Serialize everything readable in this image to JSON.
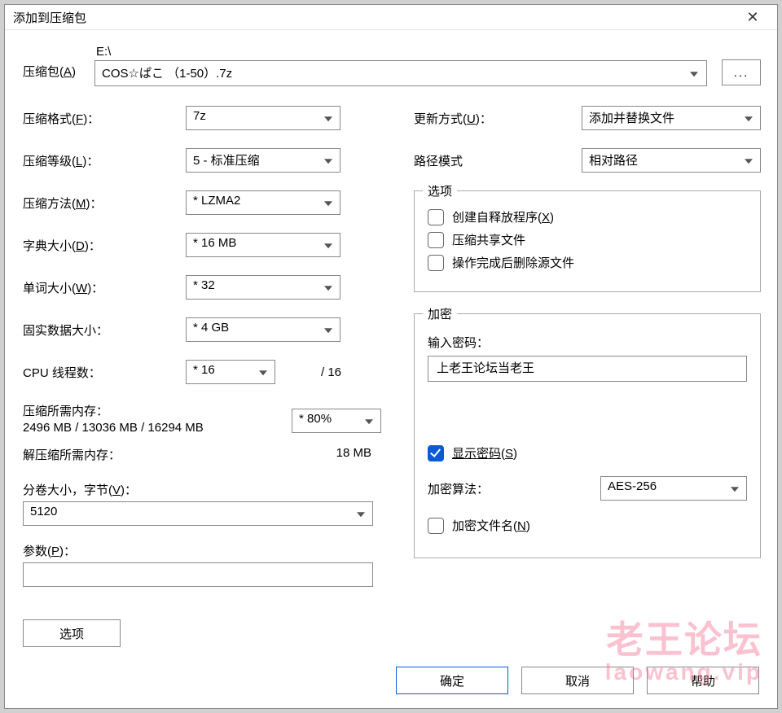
{
  "title": "添加到压缩包",
  "archive": {
    "label": "压缩包",
    "hotkey": "A",
    "path_prefix": "E:\\",
    "filename": "COS☆ぱこ （1-50）.7z",
    "browse": "..."
  },
  "left": {
    "format_label": "压缩格式",
    "format_hotkey": "F",
    "format_val": "7z",
    "level_label": "压缩等级",
    "level_hotkey": "L",
    "level_val": "5 - 标准压缩",
    "method_label": "压缩方法",
    "method_hotkey": "M",
    "method_val": "* LZMA2",
    "dict_label": "字典大小",
    "dict_hotkey": "D",
    "dict_val": "* 16 MB",
    "word_label": "单词大小",
    "word_hotkey": "W",
    "word_val": "* 32",
    "solid_label": "固实数据大小：",
    "solid_val": "* 4 GB",
    "threads_label": "CPU 线程数：",
    "threads_val": "* 16",
    "threads_max": "/ 16",
    "mem_comp_label": "压缩所需内存：",
    "mem_comp_val": "2496 MB / 13036 MB / 16294 MB",
    "mem_pct": "* 80%",
    "mem_decomp_label": "解压缩所需内存：",
    "mem_decomp_val": "18 MB",
    "split_label": "分卷大小，字节",
    "split_hotkey": "V",
    "split_val": "5120",
    "params_label": "参数",
    "params_hotkey": "P",
    "params_val": "",
    "options_btn": "选项"
  },
  "right": {
    "update_label": "更新方式",
    "update_hotkey": "U",
    "update_val": "添加并替换文件",
    "pathmode_label": "路径模式",
    "pathmode_val": "相对路径",
    "options_group": "选项",
    "opt_sfx": "创建自释放程序",
    "opt_sfx_hotkey": "X",
    "opt_shared": "压缩共享文件",
    "opt_delete": "操作完成后删除源文件",
    "enc_group": "加密",
    "pwd_label": "输入密码：",
    "pwd_val": "上老王论坛当老王",
    "show_pwd": "显示密码",
    "show_pwd_hotkey": "S",
    "enc_method_label": "加密算法：",
    "enc_method_val": "AES-256",
    "enc_names": "加密文件名",
    "enc_names_hotkey": "N"
  },
  "footer": {
    "ok": "确定",
    "cancel": "取消",
    "help": "帮助"
  },
  "watermark": {
    "line1": "老王论坛",
    "line2": "laowang.vip"
  }
}
